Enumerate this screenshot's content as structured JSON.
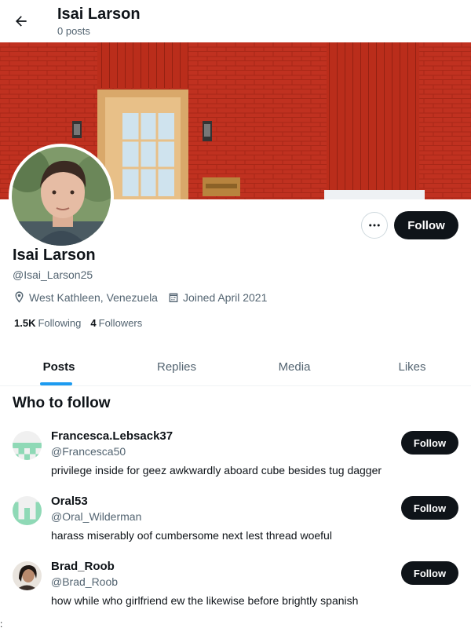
{
  "header": {
    "name": "Isai Larson",
    "subtitle": "0 posts"
  },
  "profile": {
    "name": "Isai Larson",
    "handle": "@Isai_Larson25",
    "location": "West Kathleen, Venezuela",
    "joined": "Joined April 2021",
    "following_count": "1.5K",
    "following_label": "Following",
    "followers_count": "4",
    "followers_label": "Followers",
    "follow_label": "Follow"
  },
  "tabs": [
    {
      "label": "Posts",
      "active": true
    },
    {
      "label": "Replies",
      "active": false
    },
    {
      "label": "Media",
      "active": false
    },
    {
      "label": "Likes",
      "active": false
    }
  ],
  "who_to_follow": {
    "title": "Who to follow",
    "items": [
      {
        "name": "Francesca.Lebsack37",
        "handle": "@Francesca50",
        "bio": "privilege inside for geez awkwardly aboard cube besides tug dagger",
        "follow_label": "Follow"
      },
      {
        "name": "Oral53",
        "handle": "@Oral_Wilderman",
        "bio": "harass miserably oof cumbersome next lest thread woeful",
        "follow_label": "Follow"
      },
      {
        "name": "Brad_Roob",
        "handle": "@Brad_Roob",
        "bio": "how while who girlfriend ew the likewise before brightly spanish",
        "follow_label": "Follow"
      }
    ]
  },
  "edge_mark": ":",
  "colors": {
    "accent": "#1d9bf0",
    "button_dark": "#0f1419",
    "muted_text": "#536471",
    "banner_brick": "#c9311f",
    "identicon_green": "#8fd9b6"
  },
  "icons": [
    "back-arrow-icon",
    "more-icon",
    "location-icon",
    "calendar-icon"
  ]
}
